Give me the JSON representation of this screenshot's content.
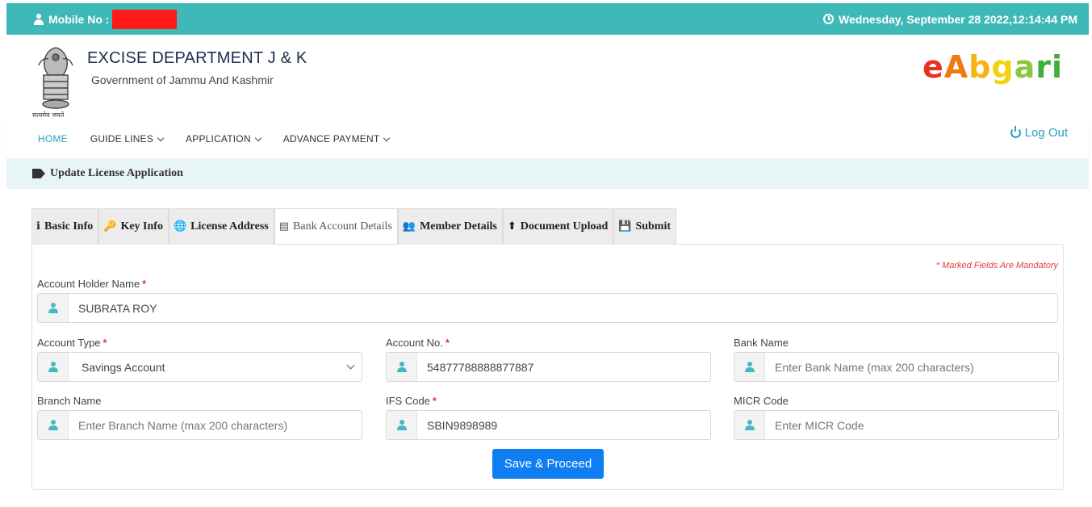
{
  "topbar": {
    "mobile_label": "Mobile No :",
    "datetime": "Wednesday, September 28 2022,12:14:44 PM"
  },
  "header": {
    "dept_title": "EXCISE DEPARTMENT J & K",
    "dept_subtitle": "Government of Jammu And Kashmir",
    "emblem_caption": "सत्यमेव जयते",
    "brand": [
      "e",
      "A",
      "b",
      "g",
      "a",
      "ri"
    ]
  },
  "nav": {
    "items": [
      {
        "label": "HOME",
        "active": true
      },
      {
        "label": "GUIDE LINES",
        "dropdown": true
      },
      {
        "label": "APPLICATION",
        "dropdown": true
      },
      {
        "label": "ADVANCE PAYMENT",
        "dropdown": true
      }
    ],
    "logout": "Log Out"
  },
  "section": {
    "title": "Update License Application"
  },
  "tabs": [
    {
      "icon": "info-icon",
      "glyph": "ℹ",
      "label": "Basic Info"
    },
    {
      "icon": "key-icon",
      "glyph": "🔑",
      "label": "Key Info"
    },
    {
      "icon": "globe-icon",
      "glyph": "🌐",
      "label": "License Address"
    },
    {
      "icon": "id-card-icon",
      "glyph": "▤",
      "label": "Bank Account Details",
      "active": true
    },
    {
      "icon": "users-icon",
      "glyph": "👥",
      "label": "Member Details"
    },
    {
      "icon": "upload-icon",
      "glyph": "⬆",
      "label": "Document Upload"
    },
    {
      "icon": "save-icon",
      "glyph": "💾",
      "label": "Submit"
    }
  ],
  "form": {
    "mandatory_note": "* Marked Fields Are Mandatory",
    "holder_name": {
      "label": "Account Holder Name",
      "required": "*",
      "value": "SUBRATA ROY"
    },
    "account_type": {
      "label": "Account Type",
      "required": "*",
      "value": "Savings Account"
    },
    "account_no": {
      "label": "Account No.",
      "required": "*",
      "value": "54877788888877887"
    },
    "bank_name": {
      "label": "Bank Name",
      "placeholder": "Enter Bank Name (max 200 characters)"
    },
    "branch_name": {
      "label": "Branch Name",
      "placeholder": "Enter Branch Name (max 200 characters)"
    },
    "ifs_code": {
      "label": "IFS Code",
      "required": "*",
      "value": "SBIN9898989"
    },
    "micr_code": {
      "label": "MICR Code",
      "placeholder": "Enter MICR Code"
    },
    "submit_label": "Save & Proceed"
  },
  "colors": {
    "topbar": "#3fb8b8",
    "accent": "#2c9fc8",
    "primary_button": "#0f7ef3",
    "required": "#e53935"
  }
}
